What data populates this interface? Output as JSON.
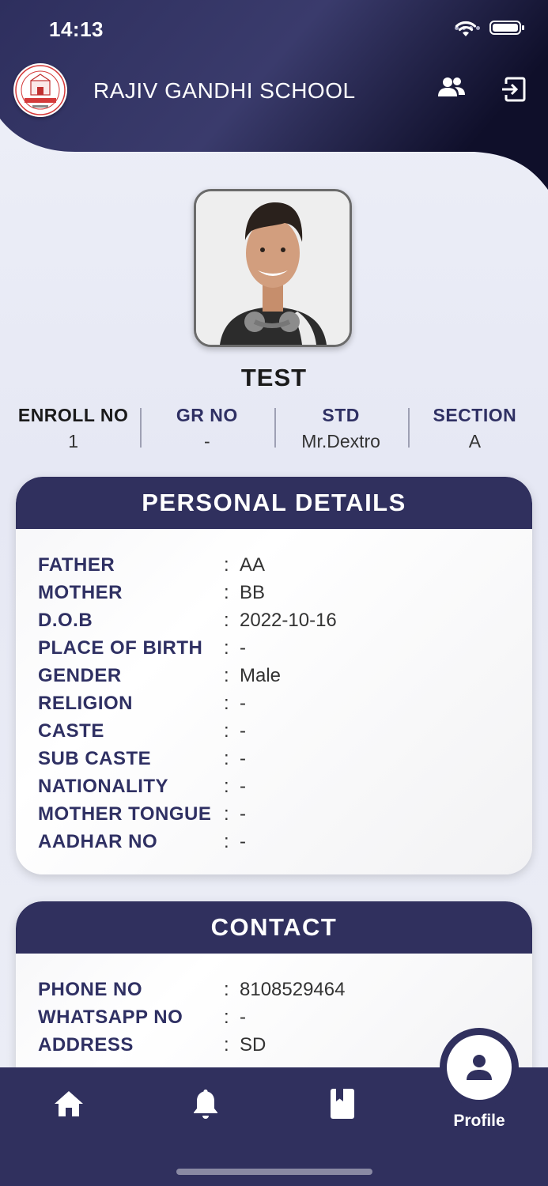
{
  "status_bar": {
    "time": "14:13"
  },
  "header": {
    "school_name": "RAJIV GANDHI SCHOOL"
  },
  "student": {
    "name": "TEST",
    "stats": [
      {
        "label": "ENROLL NO",
        "value": "1"
      },
      {
        "label": "GR NO",
        "value": "-"
      },
      {
        "label": "STD",
        "value": "Mr.Dextro"
      },
      {
        "label": "SECTION",
        "value": "A"
      }
    ]
  },
  "personal": {
    "title": "PERSONAL DETAILS",
    "rows": [
      {
        "label": "FATHER",
        "value": "AA"
      },
      {
        "label": "MOTHER",
        "value": "BB"
      },
      {
        "label": "D.O.B",
        "value": "2022-10-16"
      },
      {
        "label": "PLACE OF BIRTH",
        "value": "-"
      },
      {
        "label": "GENDER",
        "value": "Male"
      },
      {
        "label": "RELIGION",
        "value": "-"
      },
      {
        "label": "CASTE",
        "value": "-"
      },
      {
        "label": "SUB CASTE",
        "value": "-"
      },
      {
        "label": "NATIONALITY",
        "value": "-"
      },
      {
        "label": "MOTHER TONGUE",
        "value": "-"
      },
      {
        "label": "AADHAR NO",
        "value": "-"
      }
    ]
  },
  "contact": {
    "title": "CONTACT",
    "rows": [
      {
        "label": "PHONE NO",
        "value": "8108529464"
      },
      {
        "label": "WHATSAPP NO",
        "value": "-"
      },
      {
        "label": "ADDRESS",
        "value": "SD"
      }
    ]
  },
  "separator": ":",
  "nav": {
    "active_label": "Profile"
  },
  "colors": {
    "primary": "#30305e",
    "label": "#2f3063",
    "background": "#eceef6"
  },
  "icons": [
    "wifi-icon",
    "battery-icon",
    "school-logo",
    "users-icon",
    "logout-icon",
    "home-icon",
    "bell-icon",
    "book-icon",
    "profile-icon"
  ]
}
